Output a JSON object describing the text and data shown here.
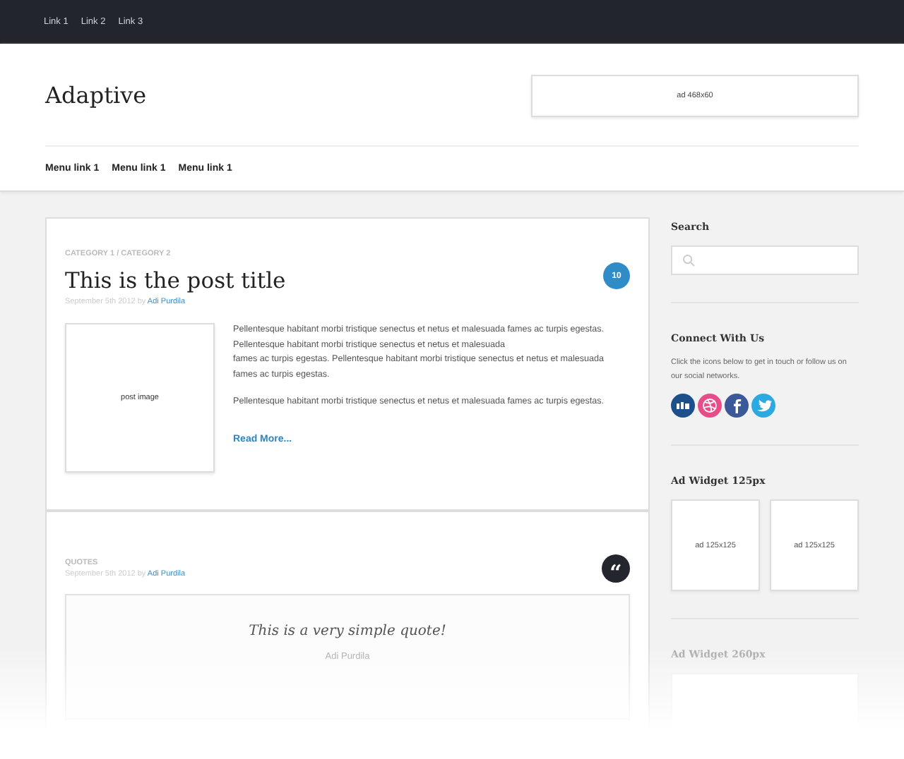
{
  "top_links": [
    "Link 1",
    "Link 2",
    "Link 3"
  ],
  "logo": "Adaptive",
  "header_ad": "ad 468x60",
  "menu": [
    "Menu link 1",
    "Menu link 1",
    "Menu link 1"
  ],
  "posts": [
    {
      "kind": "standard",
      "category": "CATEGORY 1 / CATEGORY 2",
      "title": "This is the post title",
      "date": "September 5th 2012 by",
      "author": "Adi Purdila",
      "comments": "10",
      "image_label": "post image",
      "paragraphs": [
        "Pellentesque habitant morbi tristique senectus et netus et malesuada fames ac turpis egestas. Pellentesque habitant morbi tristique senectus et netus et malesuada\nfames ac turpis egestas. Pellentesque habitant morbi tristique senectus et netus et malesuada fames ac turpis egestas.",
        "Pellentesque habitant morbi tristique senectus et netus et malesuada fames ac turpis egestas."
      ],
      "read_more": "Read More..."
    },
    {
      "kind": "quote",
      "category": "QUOTES",
      "date": "September 5th 2012 by",
      "author": "Adi Purdila",
      "quote_mark": "“",
      "quote": "This is a very simple quote!",
      "quote_author": "Adi Purdila"
    }
  ],
  "sidebar": {
    "search_title": "Search",
    "connect_title": "Connect With Us",
    "connect_text": "Click the icons below to get in touch or follow us on our social networks.",
    "social": [
      {
        "kind": "bars",
        "color": "#1d4f8c"
      },
      {
        "kind": "ball",
        "color": "#e84d8a"
      },
      {
        "kind": "letter-f",
        "color": "#3b5998"
      },
      {
        "kind": "bird",
        "color": "#2da9e1"
      }
    ],
    "ad125_title": "Ad Widget 125px",
    "ads125": [
      "ad 125x125",
      "ad 125x125"
    ],
    "ad260_title": "Ad Widget 260px"
  }
}
